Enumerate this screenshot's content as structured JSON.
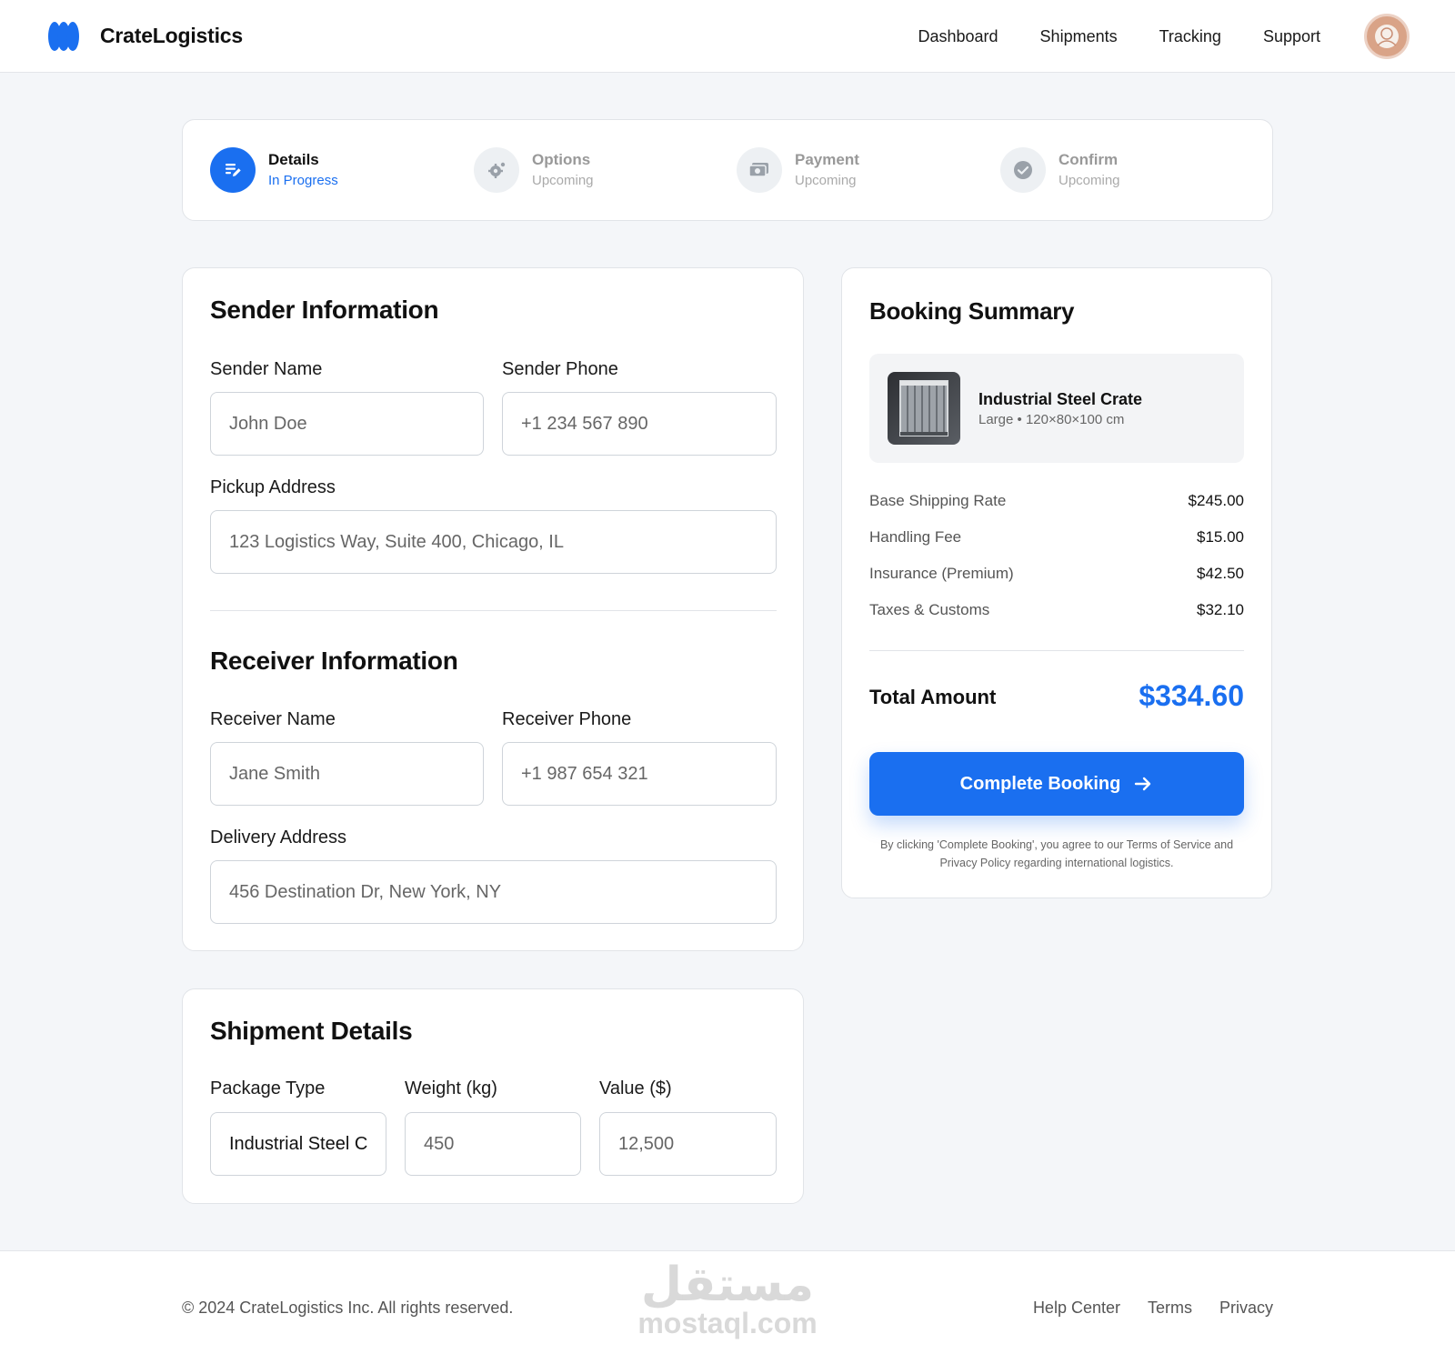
{
  "brand": {
    "name": "CrateLogistics",
    "logo_color": "#1a6ff0"
  },
  "nav": {
    "items": [
      "Dashboard",
      "Shipments",
      "Tracking",
      "Support"
    ]
  },
  "stepper": {
    "steps": [
      {
        "title": "Details",
        "status": "In Progress",
        "icon": "edit-icon"
      },
      {
        "title": "Options",
        "status": "Upcoming",
        "icon": "gear-icon"
      },
      {
        "title": "Payment",
        "status": "Upcoming",
        "icon": "payment-icon"
      },
      {
        "title": "Confirm",
        "status": "Upcoming",
        "icon": "check-circle-icon"
      }
    ]
  },
  "sender": {
    "title": "Sender Information",
    "name_label": "Sender Name",
    "name_placeholder": "John Doe",
    "phone_label": "Sender Phone",
    "phone_placeholder": "+1 234 567 890",
    "address_label": "Pickup Address",
    "address_placeholder": "123 Logistics Way, Suite 400, Chicago, IL"
  },
  "receiver": {
    "title": "Receiver Information",
    "name_label": "Receiver Name",
    "name_placeholder": "Jane Smith",
    "phone_label": "Receiver Phone",
    "phone_placeholder": "+1 987 654 321",
    "address_label": "Delivery Address",
    "address_placeholder": "456 Destination Dr, New York, NY"
  },
  "shipment": {
    "title": "Shipment Details",
    "package_label": "Package Type",
    "package_value": "Industrial Steel C",
    "weight_label": "Weight (kg)",
    "weight_placeholder": "450",
    "value_label": "Value ($)",
    "value_placeholder": "12,500"
  },
  "summary": {
    "title": "Booking Summary",
    "product": {
      "name": "Industrial Steel Crate",
      "details": "Large • 120×80×100 cm"
    },
    "fees": [
      {
        "label": "Base Shipping Rate",
        "value": "$245.00"
      },
      {
        "label": "Handling Fee",
        "value": "$15.00"
      },
      {
        "label": "Insurance (Premium)",
        "value": "$42.50"
      },
      {
        "label": "Taxes & Customs",
        "value": "$32.10"
      }
    ],
    "total_label": "Total Amount",
    "total_value": "$334.60",
    "button_label": "Complete Booking",
    "disclaimer": "By clicking 'Complete Booking', you agree to our Terms of Service and Privacy Policy regarding international logistics."
  },
  "footer": {
    "copyright": "© 2024 CrateLogistics Inc. All rights reserved.",
    "links": [
      "Help Center",
      "Terms",
      "Privacy"
    ],
    "watermark_ar": "مستقل",
    "watermark_en": "mostaql.com"
  },
  "colors": {
    "accent": "#1a6ff0",
    "background": "#f4f6f9"
  }
}
